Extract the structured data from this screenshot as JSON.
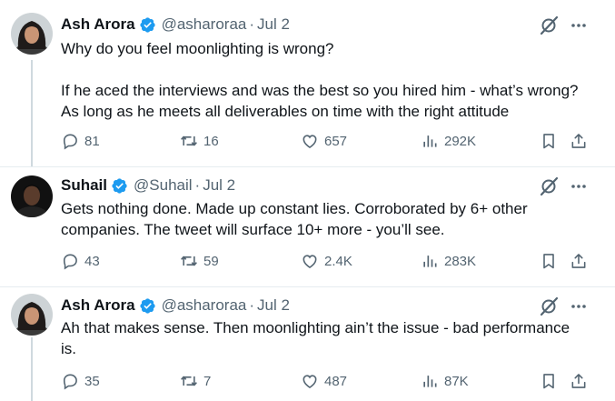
{
  "tweets": [
    {
      "name": "Ash Arora",
      "handle": "@asharoraa",
      "separator": "·",
      "time": "Jul 2",
      "lines": [
        "Why do you feel moonlighting is wrong?",
        "",
        "If he aced the interviews and was the best so you hired him - what’s wrong?",
        "As long as he meets all deliverables on time with the right attitude"
      ],
      "replies": "81",
      "retweets": "16",
      "likes": "657",
      "views": "292K"
    },
    {
      "name": "Suhail",
      "handle": "@Suhail",
      "separator": "·",
      "time": "Jul 2",
      "lines": [
        "Gets nothing done. Made up constant lies. Corroborated by 6+ other",
        "companies. The tweet will surface 10+ more - you’ll see."
      ],
      "replies": "43",
      "retweets": "59",
      "likes": "2.4K",
      "views": "283K"
    },
    {
      "name": "Ash Arora",
      "handle": "@asharoraa",
      "separator": "·",
      "time": "Jul 2",
      "lines": [
        "Ah that makes sense. Then moonlighting ain’t the issue - bad performance",
        "is."
      ],
      "replies": "35",
      "retweets": "7",
      "likes": "487",
      "views": "87K"
    }
  ],
  "colors": {
    "text": "#0f1419",
    "muted": "#536471",
    "verified": "#1d9bf0",
    "divider": "#e6ecf0",
    "thread": "#cfd9de"
  },
  "icons": [
    "verified-badge-icon",
    "grok-slash-icon",
    "more-icon",
    "reply-icon",
    "retweet-icon",
    "like-icon",
    "views-icon",
    "bookmark-icon",
    "share-icon"
  ]
}
